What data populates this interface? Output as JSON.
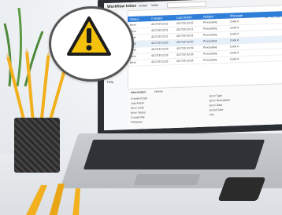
{
  "scene": {
    "bubble_icon": "warning-triangle-icon",
    "colors": {
      "warning_yellow": "#f4c20d",
      "warning_stroke": "#1d1d1d",
      "accent_blue": "#2f7ed8",
      "pencil_yellow": "#f2b01e"
    }
  },
  "app": {
    "title": "Workflow Inbox",
    "menu": [
      "Action",
      "View"
    ],
    "search_placeholder": "Search",
    "sidebar": [
      "Inbox",
      "Sent",
      "Archive",
      "Drafts",
      "Configuration",
      "Scheduling",
      "Admin",
      "Help"
    ],
    "grid_headers": [
      "Status",
      "Created",
      "Last Action",
      "Subject",
      "Message"
    ],
    "rows": [
      [
        "Error",
        "4/17/19 10:22",
        "4/17/19 10:22",
        "Processing",
        "Code 0"
      ],
      [
        "Error",
        "4/17/19 10:21",
        "4/17/19 10:21",
        "Processing",
        "Code 0"
      ],
      [
        "Error",
        "4/17/19 10:21",
        "4/17/19 10:21",
        "Processing",
        "Code 0"
      ],
      [
        "Error",
        "4/17/19 10:20",
        "4/17/19 10:20",
        "Processing",
        "Code 0"
      ],
      [
        "Error",
        "4/17/19 10:19",
        "4/17/19 10:19",
        "Processing",
        "Code 0"
      ],
      [
        "Error",
        "4/17/19 10:18",
        "4/17/19 10:18",
        "Processing",
        "Code 0"
      ],
      [
        "Error",
        "4/17/19 10:18",
        "4/17/19 10:18",
        "Processing",
        "Code 0"
      ]
    ],
    "detail": {
      "tabs": [
        "Information",
        "History"
      ],
      "left": [
        "Created Date",
        "Last Action",
        "Error Code",
        "Error Status",
        "Created By",
        "FileName"
      ],
      "right": [
        "Error Type",
        "Error Description",
        "Error Date",
        "Event Date",
        "File"
      ]
    }
  }
}
